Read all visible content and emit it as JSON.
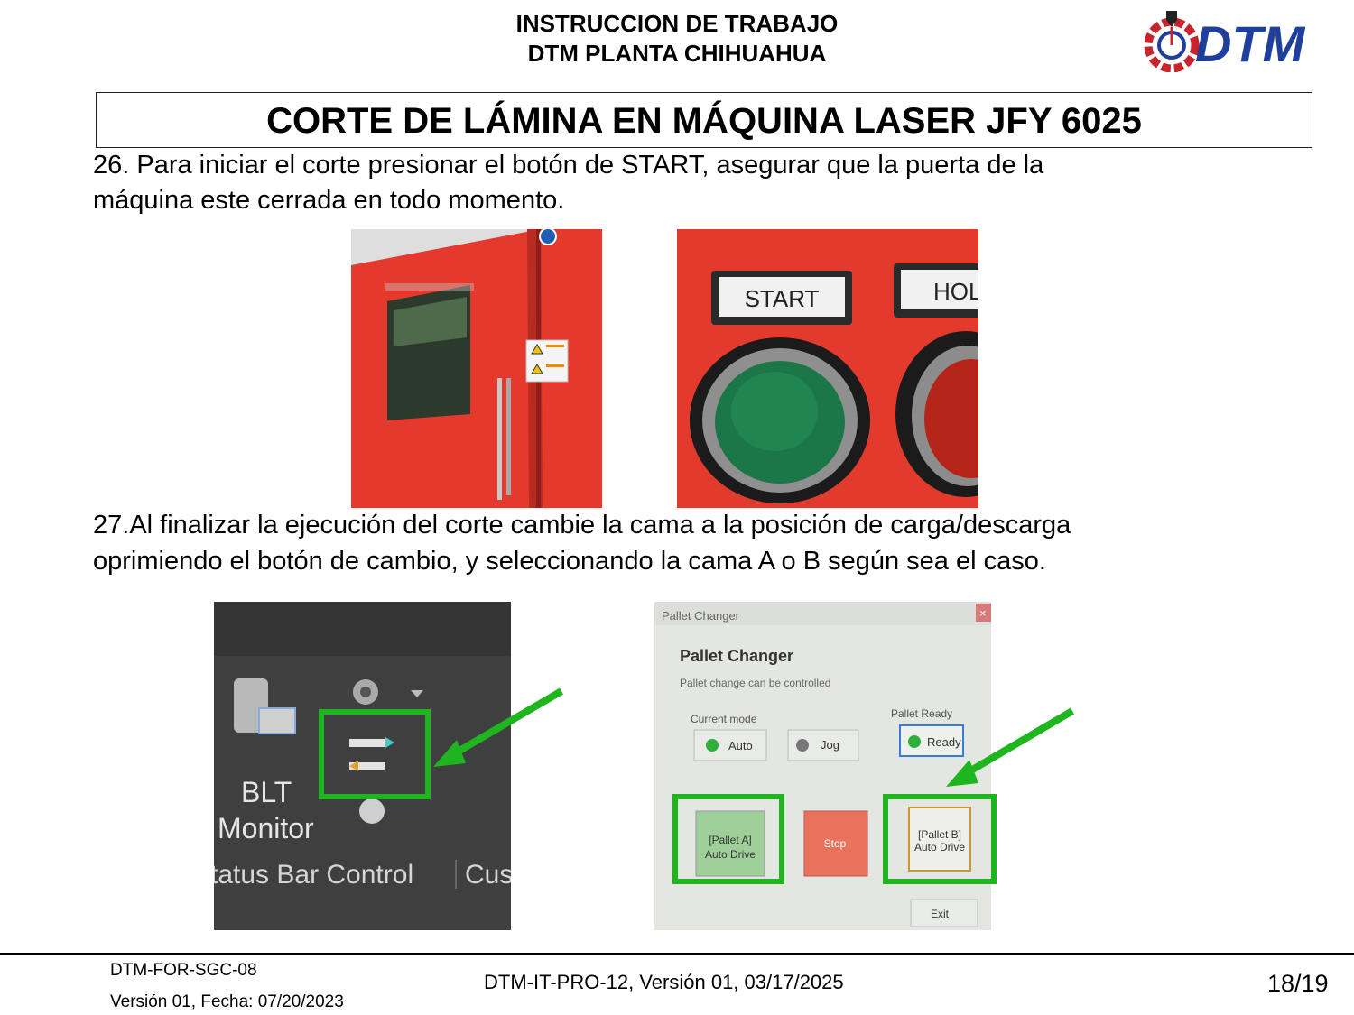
{
  "header": {
    "line1": "INSTRUCCION DE TRABAJO",
    "line2": "DTM PLANTA CHIHUAHUA",
    "logo_text": "DTM"
  },
  "title": "CORTE DE LÁMINA EN MÁQUINA LASER JFY 6025",
  "steps": [
    {
      "line1": "26.  Para iniciar el corte presionar el botón de START, asegurar que la puerta de la",
      "line2": "máquina este cerrada en todo momento."
    },
    {
      "line1": "27.Al finalizar la ejecución del corte cambie la cama a la posición de carga/descarga",
      "line2": "oprimiendo el botón de cambio, y seleccionando la cama A o B según sea el caso."
    }
  ],
  "photo_start": {
    "label_start": "START",
    "label_hold": "HOL"
  },
  "photo_monitor": {
    "line1": "BLT",
    "line2": "Monitor",
    "line3": "tatus Bar Control",
    "line3b": "Cus"
  },
  "pallet_changer": {
    "window_title": "Pallet Changer",
    "heading": "Pallet Changer",
    "subtitle": "Pallet change can be controlled",
    "current_mode_label": "Current mode",
    "mode_auto": "Auto",
    "mode_jog": "Jog",
    "pallet_ready_label": "Pallet Ready",
    "ready": "Ready",
    "pallet_a_line1": "[Pallet A]",
    "pallet_a_line2": "Auto Drive",
    "stop": "Stop",
    "pallet_b_line1": "[Pallet B]",
    "pallet_b_line2": "Auto Drive",
    "exit": "Exit",
    "close": "×"
  },
  "colors": {
    "highlight_green": "#1fb51f",
    "machine_red": "#e63a2e",
    "start_green": "#1f7a4a"
  },
  "footer": {
    "form_code": "DTM-FOR-SGC-08",
    "form_version": "Versión 01, Fecha: 07/20/2023",
    "doc_ref": "DTM-IT-PRO-12, Versión 01, 03/17/2025",
    "page": "18/19"
  }
}
